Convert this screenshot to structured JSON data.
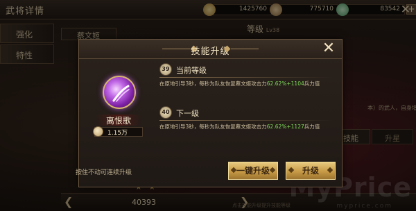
{
  "background": {
    "window_title": "武将详情",
    "resources": [
      {
        "icon": "copper-coin-icon",
        "value": "1425760",
        "color": "#d8b060"
      },
      {
        "icon": "grain-bag-icon",
        "value": "775710",
        "color": "#c8a070"
      },
      {
        "icon": "jade-icon",
        "value": "83542",
        "color": "#8ccf9a"
      }
    ],
    "side_tabs": [
      "强化",
      "特性"
    ],
    "hero_name": "蔡文姬",
    "level_label": "等级",
    "level_value": "Lv38",
    "skills_tab": "技能",
    "star_tab": "升星",
    "desc_snippet": "本）的武人，自身增加",
    "power": "40393",
    "bottom_hint": "点击技能升级提升技能等级",
    "watermark": "MyPrice",
    "watermark_sub": "myprice.com"
  },
  "modal": {
    "title": "技能升级",
    "skill": {
      "name": "离恨歌",
      "icon": "sound-wave-skill-icon",
      "cost": "1.15万"
    },
    "current": {
      "level": "39",
      "title": "当前等级",
      "desc_pre": "在原地引导3秒，每秒为队友恢复蔡文姬攻击力",
      "desc_hl": "62.62%+1104",
      "desc_post": "兵力值"
    },
    "next": {
      "level": "40",
      "title": "下一级",
      "desc_pre": "在原地引导3秒，每秒为队友恢复蔡文姬攻击力",
      "desc_hl": "62.62%+1127",
      "desc_post": "兵力值"
    },
    "hint": "按住不动可连续升级",
    "buttons": {
      "one_click": "一键升级",
      "upgrade": "升级"
    }
  }
}
